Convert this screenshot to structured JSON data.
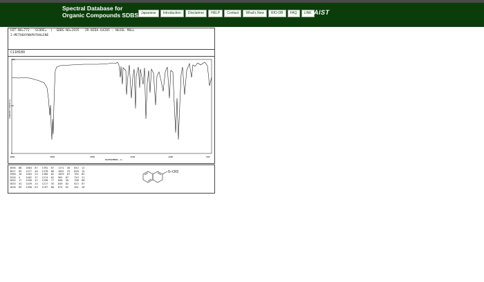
{
  "header": {
    "title_line1": "Spectral Database for",
    "title_line2": "Organic Compounds SDBS",
    "nav": [
      "Japanese",
      "Introduction",
      "Disclaimer",
      "HELP",
      "Contact",
      "What's New",
      "RIO-DB",
      "FAQ",
      "LINK"
    ],
    "logo": "AIST"
  },
  "record": {
    "line1": "HIT-NO=772   SCORE=  )  SDBS-NO=1935   IR-NIDA-64285 : NUJOL MULL",
    "compound_name": "2-METHOXYNAPHTHALENE",
    "formula": "C11H10O"
  },
  "spectrum": {
    "y_axis_label": "TRANSMITTANCE(%)",
    "x_axis_label": "WAVENUMBER(-1)",
    "y_ticks": [
      "100",
      "50",
      "0"
    ],
    "x_ticks": [
      "4000",
      "3000",
      "2000",
      "1500",
      "1000",
      "500"
    ]
  },
  "peak_table": [
    [
      [
        "3056",
        "88"
      ],
      [
        "3027",
        "85"
      ],
      [
        "2960",
        "16"
      ],
      [
        "2926",
        "4"
      ],
      [
        "2855",
        "17"
      ],
      [
        "2833",
        "44"
      ],
      [
        "1630",
        "69"
      ]
    ],
    [
      [
        "1604",
        "87"
      ],
      [
        "1477",
        "46"
      ],
      [
        "1463",
        "23"
      ],
      [
        "1462",
        "37"
      ],
      [
        "1450",
        "41"
      ],
      [
        "1439",
        "14"
      ],
      [
        "1390",
        "63"
      ]
    ],
    [
      [
        "1392",
        "87"
      ],
      [
        "1378",
        "86"
      ],
      [
        "1360",
        "82"
      ],
      [
        "1274",
        "62"
      ],
      [
        "1258",
        "77"
      ],
      [
        "1217",
        "35"
      ],
      [
        "1197",
        "86"
      ]
    ],
    [
      [
        "1171",
        "30"
      ],
      [
        "1032",
        "25"
      ],
      [
        "1029",
        "87"
      ],
      [
        "962",
        "87"
      ],
      [
        "846",
        "50"
      ],
      [
        "849",
        "82"
      ],
      [
        "874",
        "62"
      ]
    ],
    [
      [
        "842",
        "12"
      ],
      [
        "828",
        "15"
      ],
      [
        "765",
        "82"
      ],
      [
        "743",
        "21"
      ],
      [
        "708",
        "68"
      ],
      [
        "623",
        "87"
      ],
      [
        "481",
        "28"
      ]
    ]
  ],
  "structure": {
    "substituent": "O—CH3"
  }
}
